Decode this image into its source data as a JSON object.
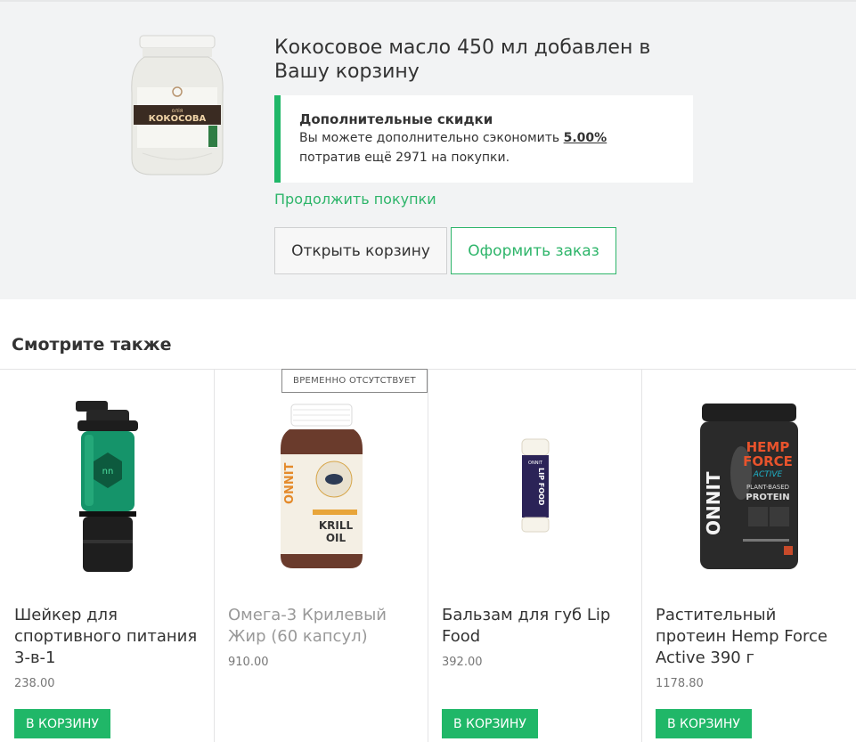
{
  "added": {
    "title": "Кокосовое масло 450 мл добавлен в Вашу корзину",
    "jar_label_top": "олія",
    "jar_label_main": "КОКОСОВА"
  },
  "discount": {
    "title": "Дополнительные скидки",
    "text_before": "Вы можете дополнительно сэкономить ",
    "percent": "5.00%",
    "text_after": "потратив ещё 2971 на покупки."
  },
  "continue_link": "Продолжить покупки",
  "buttons": {
    "open_cart": "Открыть корзину",
    "checkout": "Оформить заказ"
  },
  "see_also": "Смотрите также",
  "badge": "ВРЕМЕННО ОТСУТСТВУЕТ",
  "products": [
    {
      "name": "Шейкер для спортивного питания 3-в-1",
      "price": "238.00",
      "button": "В КОРЗИНУ"
    },
    {
      "name": "Омега-3 Крилевый Жир (60 капсул)",
      "price": "910.00",
      "button": ""
    },
    {
      "name": "Бальзам для губ Lip Food",
      "price": "392.00",
      "button": "В КОРЗИНУ"
    },
    {
      "name": "Растительный протеин Hemp Force Active 390 г",
      "price": "1178.80",
      "button": "В КОРЗИНУ"
    }
  ],
  "product_labels": {
    "krill_brand": "ONNIT",
    "krill_line1": "KRILL",
    "krill_line2": "OIL",
    "lip_brand": "ONNIT",
    "lip_text": "LIP FOOD",
    "hemp_brand": "ONNIT",
    "hemp_line1": "HEMP",
    "hemp_line2": "FORCE",
    "hemp_line3": "ACTIVE",
    "hemp_line4": "PLANT-BASED",
    "hemp_line5": "PROTEIN"
  },
  "colors": {
    "accent_green": "#20b768",
    "link_green": "#2eb56a",
    "background_gray": "#f2f3f4"
  }
}
